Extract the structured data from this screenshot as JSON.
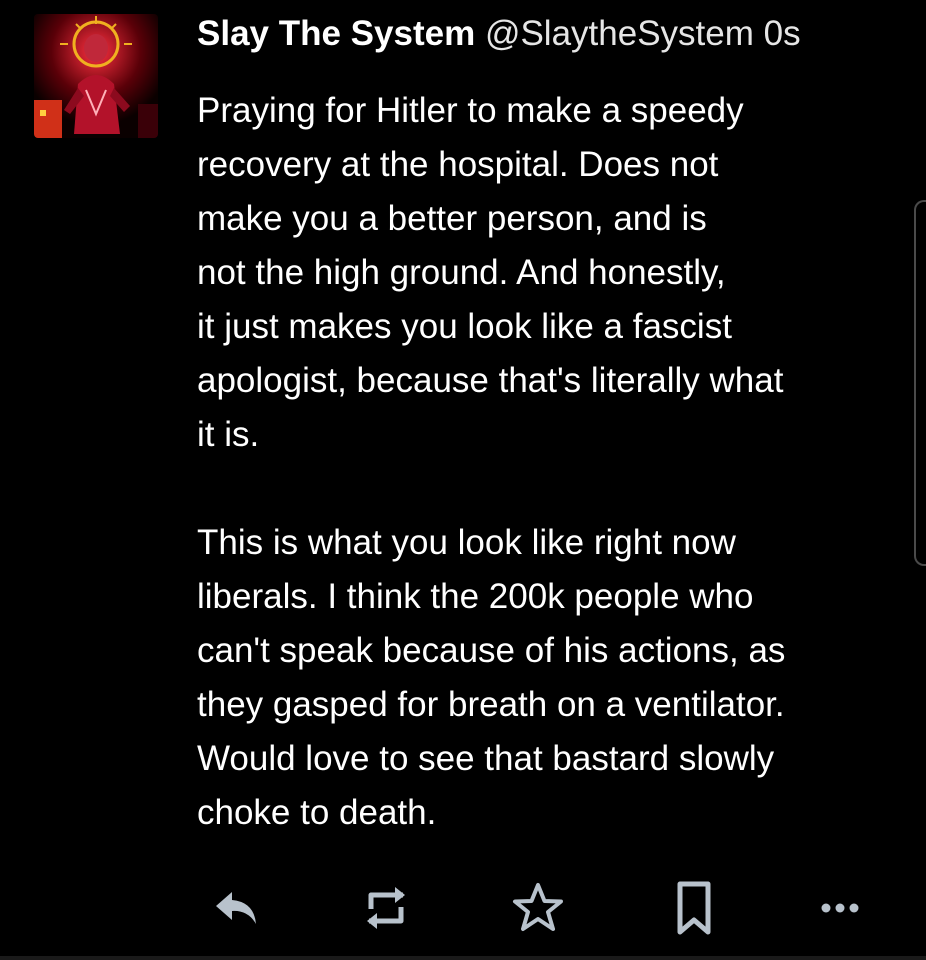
{
  "tweet": {
    "display_name": "Slay The System",
    "handle": "@SlaytheSystem",
    "time": "0s",
    "lines_para1": [
      "Praying for Hitler to make a speedy",
      "recovery at the hospital. Does not",
      "make you a better person, and is",
      "not the high ground. And honestly,",
      "it just makes you look like a fascist",
      "apologist, because that's literally what",
      "it is."
    ],
    "lines_para2": [
      "This is what you look like right now",
      "liberals. I think the 200k people who",
      "can't speak because of his actions, as",
      "they gasped for breath on a ventilator.",
      "Would love to see that bastard slowly",
      "choke to death."
    ]
  },
  "actions": [
    {
      "icon": "reply-icon"
    },
    {
      "icon": "retweet-icon"
    },
    {
      "icon": "star-icon"
    },
    {
      "icon": "bookmark-icon"
    },
    {
      "icon": "more-icon"
    }
  ],
  "colors": {
    "background": "#000000",
    "text": "#ffffff",
    "icon": "#b8c2cc"
  }
}
